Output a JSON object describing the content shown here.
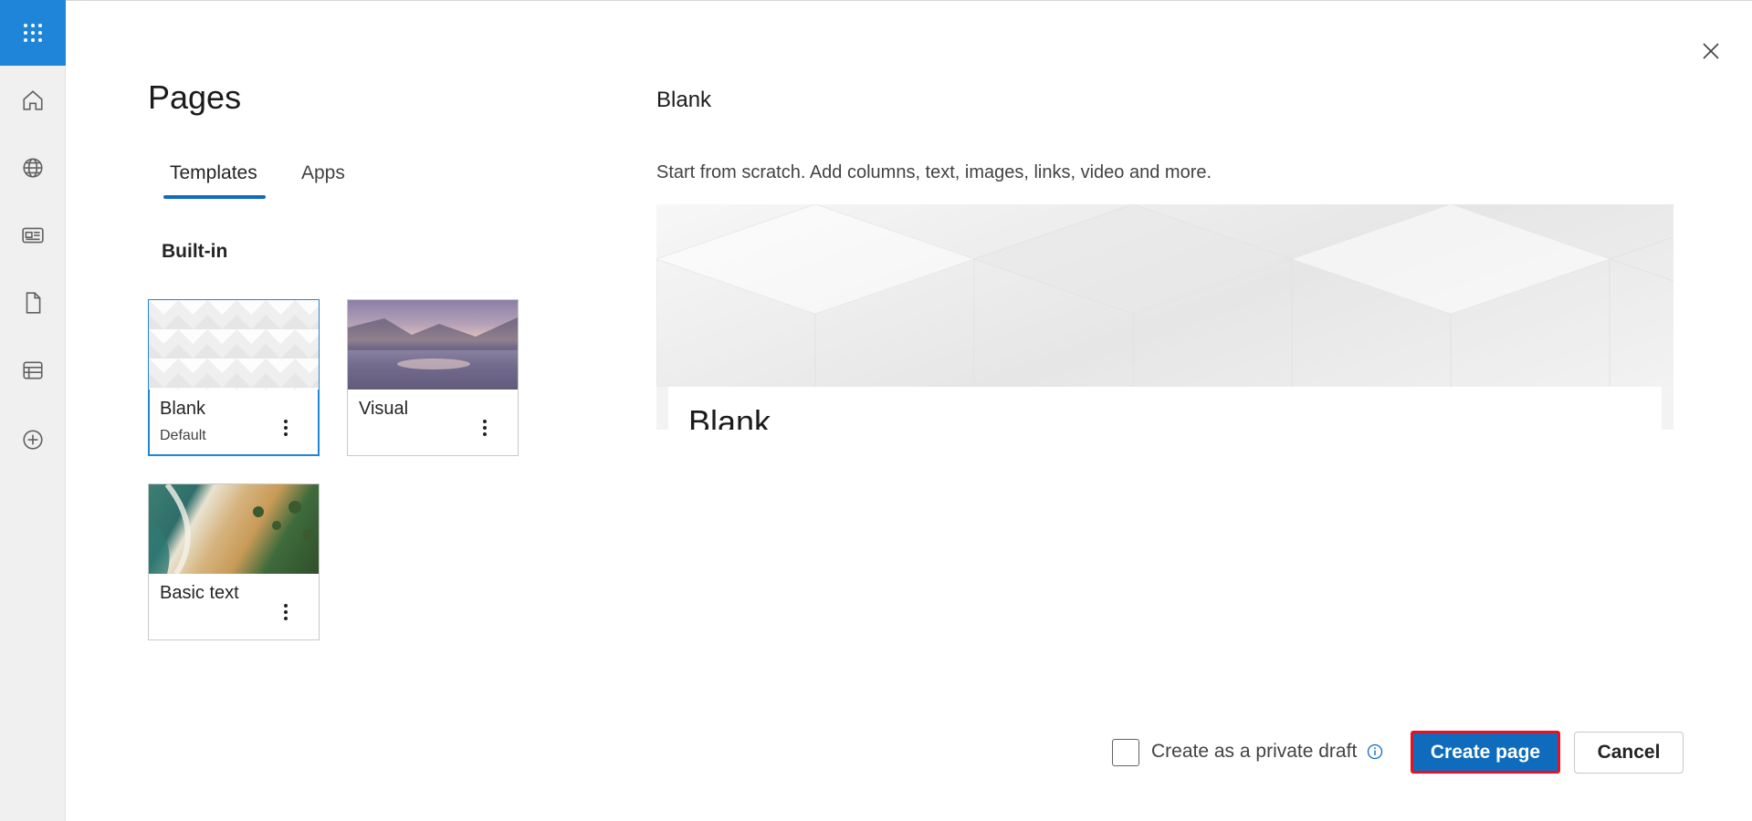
{
  "rail": {
    "items": [
      {
        "icon": "waffle-icon"
      },
      {
        "icon": "home-icon"
      },
      {
        "icon": "globe-icon"
      },
      {
        "icon": "news-icon"
      },
      {
        "icon": "document-icon"
      },
      {
        "icon": "list-icon"
      },
      {
        "icon": "add-circle-icon"
      }
    ]
  },
  "panel": {
    "title": "Pages",
    "tabs": [
      {
        "label": "Templates",
        "active": true
      },
      {
        "label": "Apps",
        "active": false
      }
    ],
    "section": "Built-in",
    "templates": [
      {
        "name": "Blank",
        "sub": "Default",
        "selected": true
      },
      {
        "name": "Visual",
        "sub": "",
        "selected": false
      },
      {
        "name": "Basic text",
        "sub": "",
        "selected": false
      }
    ]
  },
  "preview": {
    "title": "Blank",
    "description": "Start from scratch. Add columns, text, images, links, video and more.",
    "card_title": "Blank"
  },
  "footer": {
    "private_draft_label": "Create as a private draft",
    "private_draft_checked": false,
    "create_label": "Create page",
    "cancel_label": "Cancel"
  },
  "colors": {
    "accent": "#0f6cbd",
    "waffle_bg": "#1f85d8",
    "highlight_border": "#e81123"
  }
}
